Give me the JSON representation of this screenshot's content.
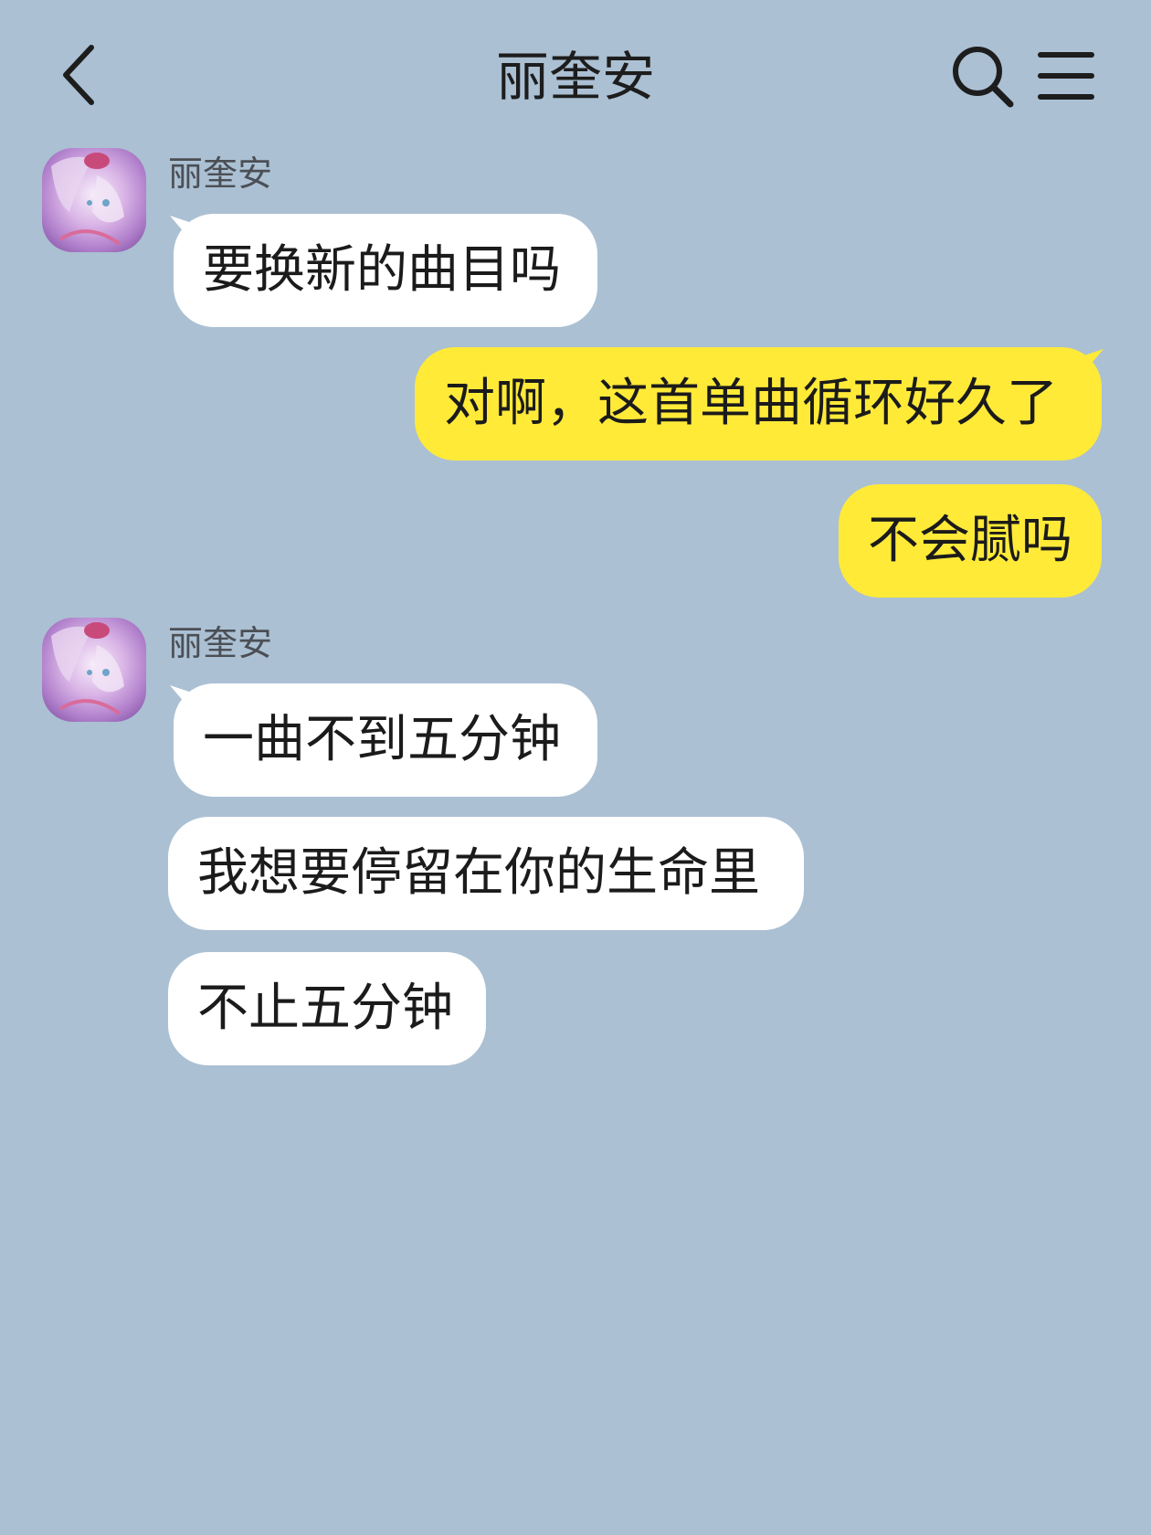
{
  "header": {
    "title": "丽奎安",
    "back_icon": "chevron-left-icon",
    "search_icon": "search-icon",
    "menu_icon": "hamburger-menu-icon"
  },
  "colors": {
    "background": "#abc0d3",
    "incoming_bubble": "#ffffff",
    "outgoing_bubble": "#ffea38",
    "text": "#1b1b1b",
    "sender_name": "#4b4f55"
  },
  "messages": [
    {
      "group": 0,
      "direction": "incoming",
      "sender": "丽奎安",
      "text": "要换新的曲目吗"
    },
    {
      "group": 1,
      "direction": "outgoing",
      "text": "对啊，这首单曲循环好久了"
    },
    {
      "group": 1,
      "direction": "outgoing",
      "text": "不会腻吗"
    },
    {
      "group": 2,
      "direction": "incoming",
      "sender": "丽奎安",
      "text": "一曲不到五分钟"
    },
    {
      "group": 2,
      "direction": "incoming",
      "text": "我想要停留在你的生命里"
    },
    {
      "group": 2,
      "direction": "incoming",
      "text": "不止五分钟"
    }
  ]
}
